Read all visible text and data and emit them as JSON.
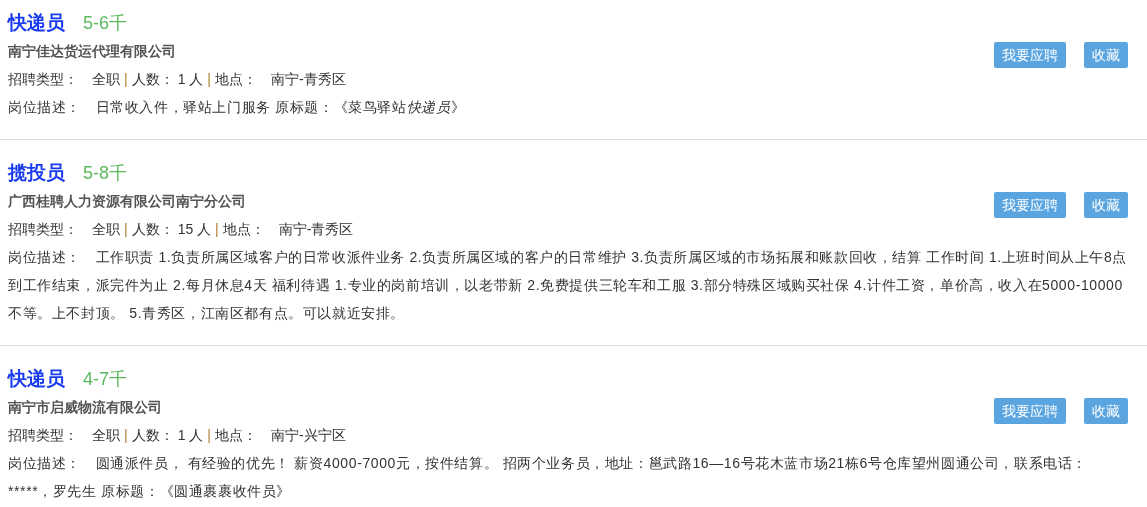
{
  "jobs": [
    {
      "title": "快递员",
      "salary": "5-6千",
      "company": "南宁佳达货运代理有限公司",
      "type_label": "招聘类型：",
      "type": "全职",
      "separator_1": "|",
      "count_label": "人数：",
      "count": "1 人",
      "separator_2": "|",
      "location_label": "地点：",
      "location": "南宁-青秀区",
      "desc_label": "岗位描述：",
      "desc": [
        {
          "text": "日常收入件，驿站上门服务 原标题：《菜鸟驿站",
          "italic": false
        },
        {
          "text": "快递员",
          "italic": true
        },
        {
          "text": "》",
          "italic": false
        }
      ],
      "apply": "我要应聘",
      "save": "收藏"
    },
    {
      "title": "揽投员",
      "salary": "5-8千",
      "company": "广西桂聘人力资源有限公司南宁分公司",
      "type_label": "招聘类型：",
      "type": "全职",
      "separator_1": "|",
      "count_label": "人数：",
      "count": "15 人",
      "separator_2": "|",
      "location_label": "地点：",
      "location": "南宁-青秀区",
      "desc_label": "岗位描述：",
      "desc": [
        {
          "text": "工作职责 1.负责所属区域客户的日常收派件业务 2.负责所属区域的客户的日常维护 3.负责所属区域的市场拓展和账款回收，结算 工作时间 1.上班时间从上午8点到工作结束，派完件为止 2.每月休息4天 福利待遇 1.专业的岗前培训，以老带新 2.免费提供三轮车和工服 3.部分特殊区域购买社保 4.计件工资，单价高，收入在5000-10000不等。上不封顶。 5.青秀区，江南区都有点。可以就近安排。",
          "italic": false
        }
      ],
      "apply": "我要应聘",
      "save": "收藏"
    },
    {
      "title": "快递员",
      "salary": "4-7千",
      "company": "南宁市启威物流有限公司",
      "type_label": "招聘类型：",
      "type": "全职",
      "separator_1": "|",
      "count_label": "人数：",
      "count": "1 人",
      "separator_2": "|",
      "location_label": "地点：",
      "location": "南宁-兴宁区",
      "desc_label": "岗位描述：",
      "desc": [
        {
          "text": "圆通派件员， 有经验的优先！ 薪资4000-7000元，按件结算。 招两个业务员，地址：邕武路16—16号花木蓝市场21栋6号仓库望州圆通公司，联系电话：*****，罗先生 原标题：《圆通裹裹收件员》",
          "italic": false
        }
      ],
      "apply": "我要应聘",
      "save": "收藏"
    }
  ]
}
